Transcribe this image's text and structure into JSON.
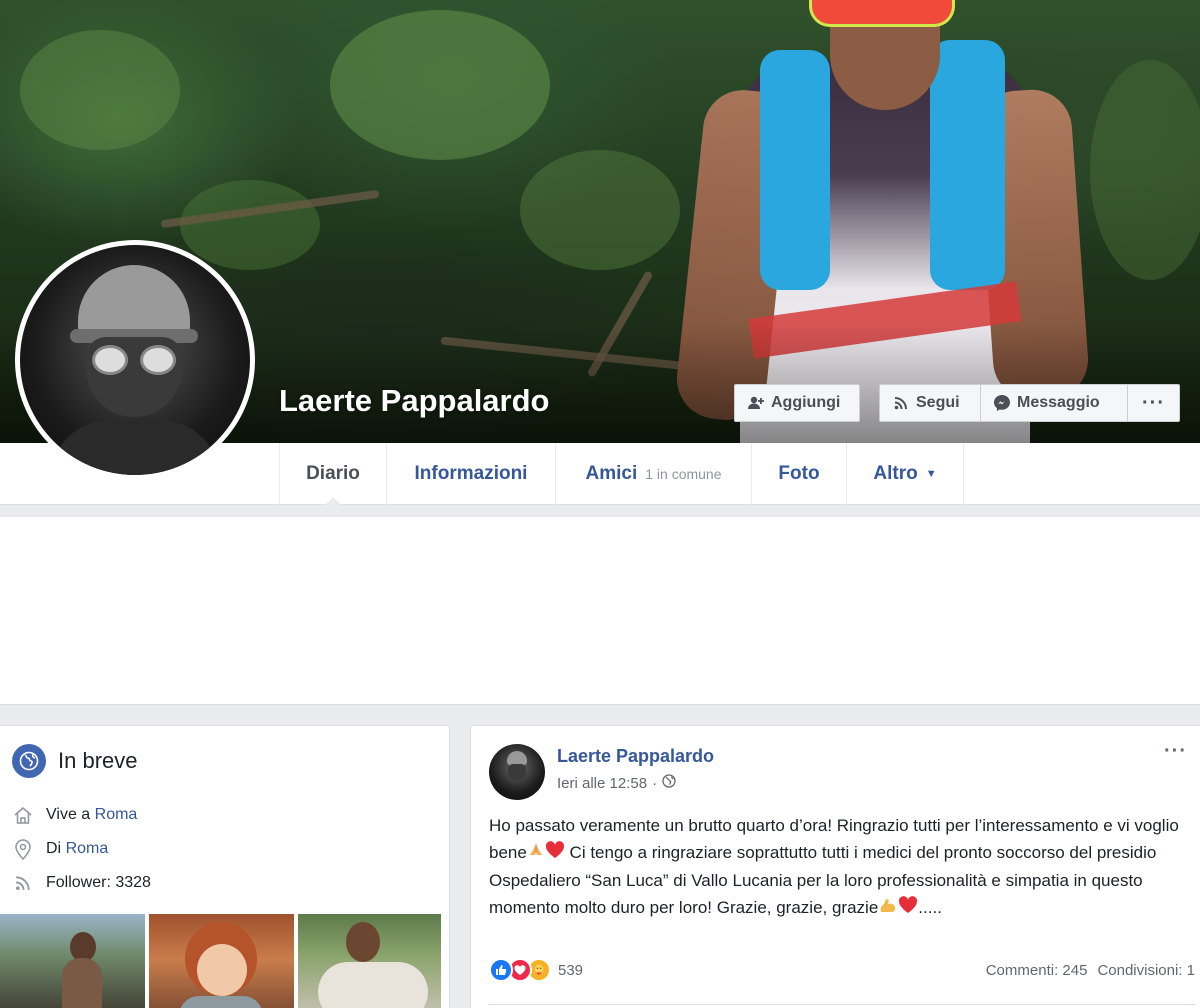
{
  "profile": {
    "name": "Laerte Pappalardo"
  },
  "actions": {
    "add_friend": "Aggiungi",
    "follow": "Segui",
    "message": "Messaggio",
    "more": "···"
  },
  "tabs": [
    {
      "label": "Diario",
      "active": true
    },
    {
      "label": "Informazioni"
    },
    {
      "label": "Amici",
      "sub": "1 in comune"
    },
    {
      "label": "Foto"
    },
    {
      "label": "Altro"
    }
  ],
  "intro": {
    "title": "In breve",
    "lives_prefix": "Vive a ",
    "lives_city": "Roma",
    "from_prefix": "Di ",
    "from_city": "Roma",
    "followers": "Follower: 3328"
  },
  "post": {
    "author": "Laerte Pappalardo",
    "time": "Ieri alle 12:58",
    "time_sep": "·",
    "more": "···",
    "text_1": "Ho passato veramente un brutto quarto d’ora! Ringrazio tutti per l’interessamento e vi voglio bene",
    "text_2": " Ci tengo a ringraziare soprattutto tutti i medici del pronto soccorso del presidio Ospedaliero “San Luca” di Vallo Lucania per la loro professionalità e simpatia in questo momento molto duro per loro! Grazie, grazie, grazie",
    "text_3": ".....",
    "reaction_count": "539",
    "comments": "Commenti: 245",
    "shares": "Condivisioni: 1"
  },
  "colors": {
    "link": "#365899",
    "facebook_blue": "#4267b2",
    "background": "#e9ebee"
  },
  "icons": {
    "add_friend": "add-friend-icon",
    "follow": "rss-icon",
    "message": "messenger-icon",
    "intro": "globe-icon",
    "lives": "home-icon",
    "from": "location-pin-icon",
    "followers": "rss-icon",
    "privacy": "globe-icon",
    "reactions": [
      "like-icon",
      "love-icon",
      "care-icon"
    ]
  }
}
